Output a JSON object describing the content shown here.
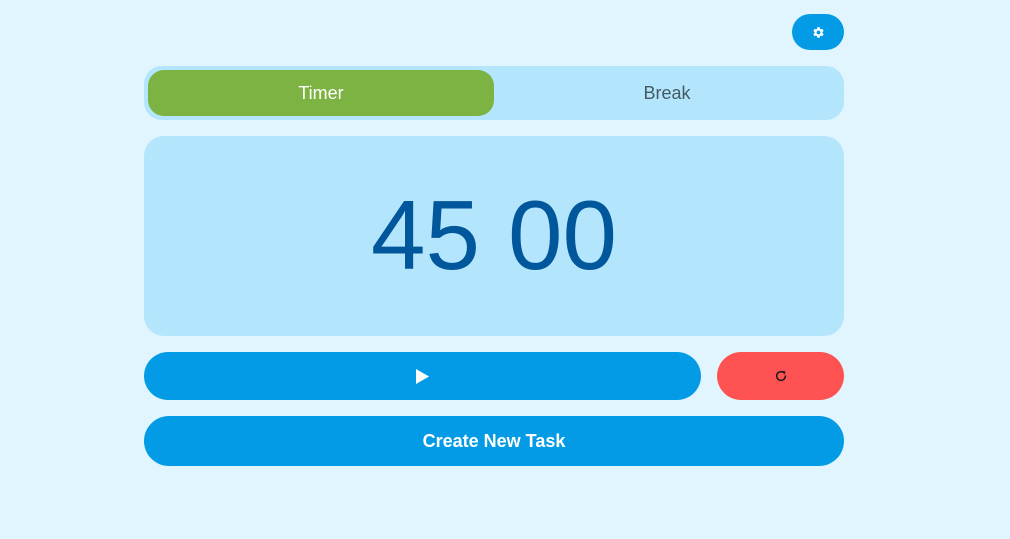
{
  "header": {
    "settings_icon": "gear-icon"
  },
  "tabs": [
    {
      "label": "Timer",
      "active": true
    },
    {
      "label": "Break",
      "active": false
    }
  ],
  "timer": {
    "minutes": "45",
    "seconds": "00"
  },
  "controls": {
    "play_icon": "play-icon",
    "reset_icon": "reset-icon",
    "create_task_label": "Create New Task"
  },
  "colors": {
    "background": "#e1f5fe",
    "primary": "#039be5",
    "active_tab": "#7cb342",
    "reset": "#ff5252",
    "panel": "#b3e5fc",
    "timer_text": "#01579b"
  }
}
